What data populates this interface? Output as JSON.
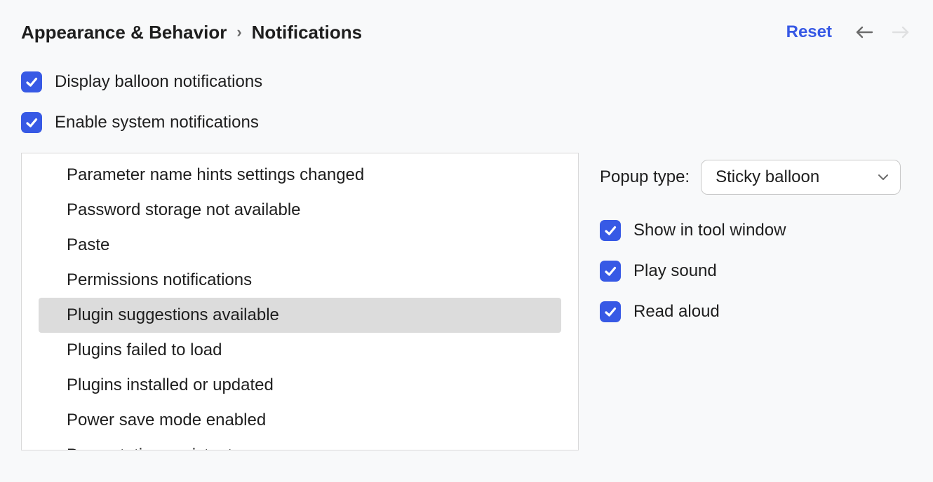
{
  "breadcrumb": {
    "root": "Appearance & Behavior",
    "leaf": "Notifications"
  },
  "actions": {
    "reset": "Reset"
  },
  "options": {
    "display_balloon": "Display balloon notifications",
    "enable_system": "Enable system notifications"
  },
  "list": {
    "items": [
      "Parameter name hints settings changed",
      "Password storage not available",
      "Paste",
      "Permissions notifications",
      "Plugin suggestions available",
      "Plugins failed to load",
      "Plugins installed or updated",
      "Power save mode enabled",
      "Presentation assistant"
    ],
    "selected_index": 4
  },
  "side": {
    "popup_type_label": "Popup type:",
    "popup_type_value": "Sticky balloon",
    "show_in_tool_window": "Show in tool window",
    "play_sound": "Play sound",
    "read_aloud": "Read aloud"
  }
}
